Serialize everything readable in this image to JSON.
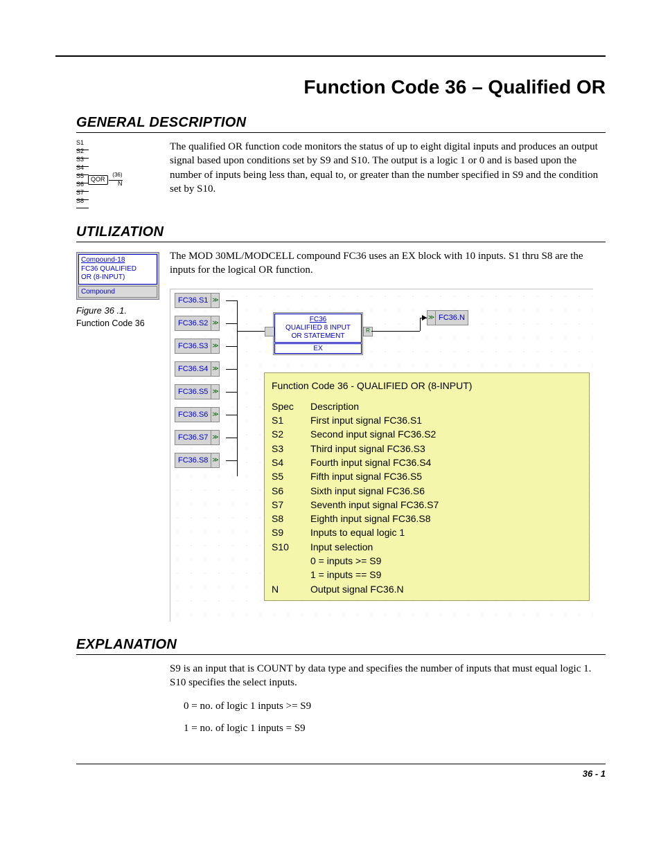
{
  "title": "Function Code 36 – Qualified OR",
  "sections": {
    "general": {
      "heading": "GENERAL DESCRIPTION",
      "body": "The qualified OR function code monitors the status of up to eight digital inputs and produces an output signal based upon conditions set by S9 and S10. The output is a logic 1 or 0 and is based upon the number of inputs being less than, equal to, or greater than the number specified in S9 and the condition set by S10."
    },
    "utilization": {
      "heading": "UTILIZATION",
      "body": "The MOD 30ML/MODCELL compound FC36 uses an EX block with 10 inputs. S1 thru S8 are the inputs for the logical OR function."
    },
    "explanation": {
      "heading": "EXPLANATION",
      "body": "S9 is an input that is COUNT by data type and specifies the number of inputs that must equal logic 1. S10 specifies the select inputs.",
      "eq0": "0 = no. of logic 1 inputs >= S9",
      "eq1": "1 = no. of logic 1 inputs = S9"
    }
  },
  "qor_icon": {
    "inputs": [
      "S1",
      "S2",
      "S3",
      "S4",
      "S5",
      "S6",
      "S7",
      "S8"
    ],
    "gate": "QOR",
    "paren": "(36)",
    "out": "N"
  },
  "compound_box": {
    "title": "Compound-18",
    "line2": "FC36   QUALIFIED",
    "line3": "OR (8-INPUT)",
    "button": "Compound"
  },
  "figure": {
    "label": "Figure 36 .1.",
    "caption": "Function Code 36"
  },
  "diagram": {
    "inputs": [
      "FC36.S1",
      "FC36.S2",
      "FC36.S3",
      "FC36.S4",
      "FC36.S5",
      "FC36.S6",
      "FC36.S7",
      "FC36.S8"
    ],
    "center": {
      "name": "FC36",
      "line2": "QUALIFIED 8 INPUT",
      "line3": "OR STATEMENT",
      "ex": "EX"
    },
    "output": "FC36.N",
    "pane": {
      "title": "Function Code 36 - QUALIFIED OR (8-INPUT)",
      "head_spec": "Spec",
      "head_desc": "Description",
      "rows": [
        {
          "spec": "S1",
          "desc": "First input signal FC36.S1"
        },
        {
          "spec": "S2",
          "desc": "Second input signal FC36.S2"
        },
        {
          "spec": "S3",
          "desc": "Third input signal FC36.S3"
        },
        {
          "spec": "S4",
          "desc": "Fourth input signal FC36.S4"
        },
        {
          "spec": "S5",
          "desc": "Fifth input signal FC36.S5"
        },
        {
          "spec": "S6",
          "desc": "Sixth input signal FC36.S6"
        },
        {
          "spec": "S7",
          "desc": "Seventh input signal FC36.S7"
        },
        {
          "spec": "S8",
          "desc": "Eighth input signal FC36.S8"
        },
        {
          "spec": "S9",
          "desc": "Inputs to equal logic 1"
        },
        {
          "spec": "S10",
          "desc": "Input selection"
        },
        {
          "spec": "",
          "desc": "0 = inputs >= S9"
        },
        {
          "spec": "",
          "desc": "1 = inputs == S9"
        },
        {
          "spec": "N",
          "desc": "Output signal FC36.N"
        }
      ]
    }
  },
  "footer": "36 - 1"
}
